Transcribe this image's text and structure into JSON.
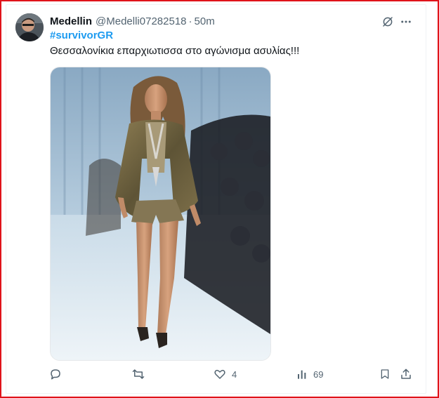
{
  "tweet": {
    "author_name": "Medellin",
    "author_handle": "@Medelli07282518",
    "separator": "·",
    "time": "50m",
    "hashtag": "#survivorGR",
    "text": "Θεσσαλονίκια επαρχιωτισσα στο αγώνισμα ασυλίας!!!"
  },
  "icons": {
    "grok": "grok-icon",
    "more": "more-icon",
    "reply": "reply-icon",
    "retweet": "retweet-icon",
    "like": "heart-icon",
    "views": "views-icon",
    "bookmark": "bookmark-icon",
    "share": "share-icon"
  },
  "actions": {
    "likes_count": "4",
    "views_count": "69"
  },
  "colors": {
    "accent": "#1d9bf0",
    "text_secondary": "#536471",
    "frame": "#e0131a"
  }
}
